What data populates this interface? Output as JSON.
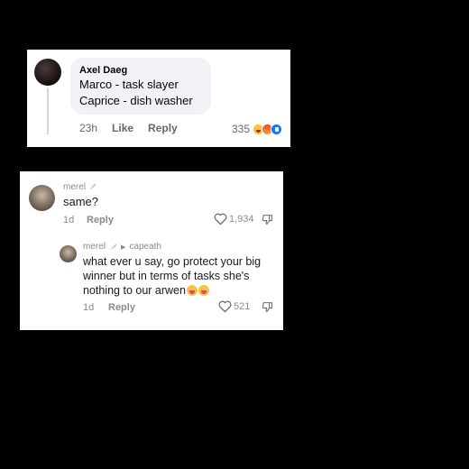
{
  "fb_comment": {
    "author": "Axel Daeg",
    "lines": [
      "Marco  - task slayer",
      "Caprice -  dish washer"
    ],
    "time": "23h",
    "like_label": "Like",
    "reply_label": "Reply",
    "reaction_count": "335",
    "reaction_icons": [
      "laugh-emoji-icon",
      "angry-emoji-icon",
      "like-thumb-icon"
    ]
  },
  "tiktok_comments": {
    "first": {
      "username": "merel",
      "text": "same?",
      "date": "1d",
      "reply_label": "Reply",
      "likes": "1,934"
    },
    "reply": {
      "username": "merel",
      "reply_to": "capeath",
      "text": "what ever u say, go protect your big winner but in terms of tasks she's nothing to our arwen",
      "date": "1d",
      "reply_label": "Reply",
      "likes": "521"
    }
  },
  "colors": {
    "background": "#000000",
    "fb_bubble": "#f0f2f5",
    "fb_like_blue": "#1877f2",
    "meta_gray": "#8a8a8a"
  }
}
